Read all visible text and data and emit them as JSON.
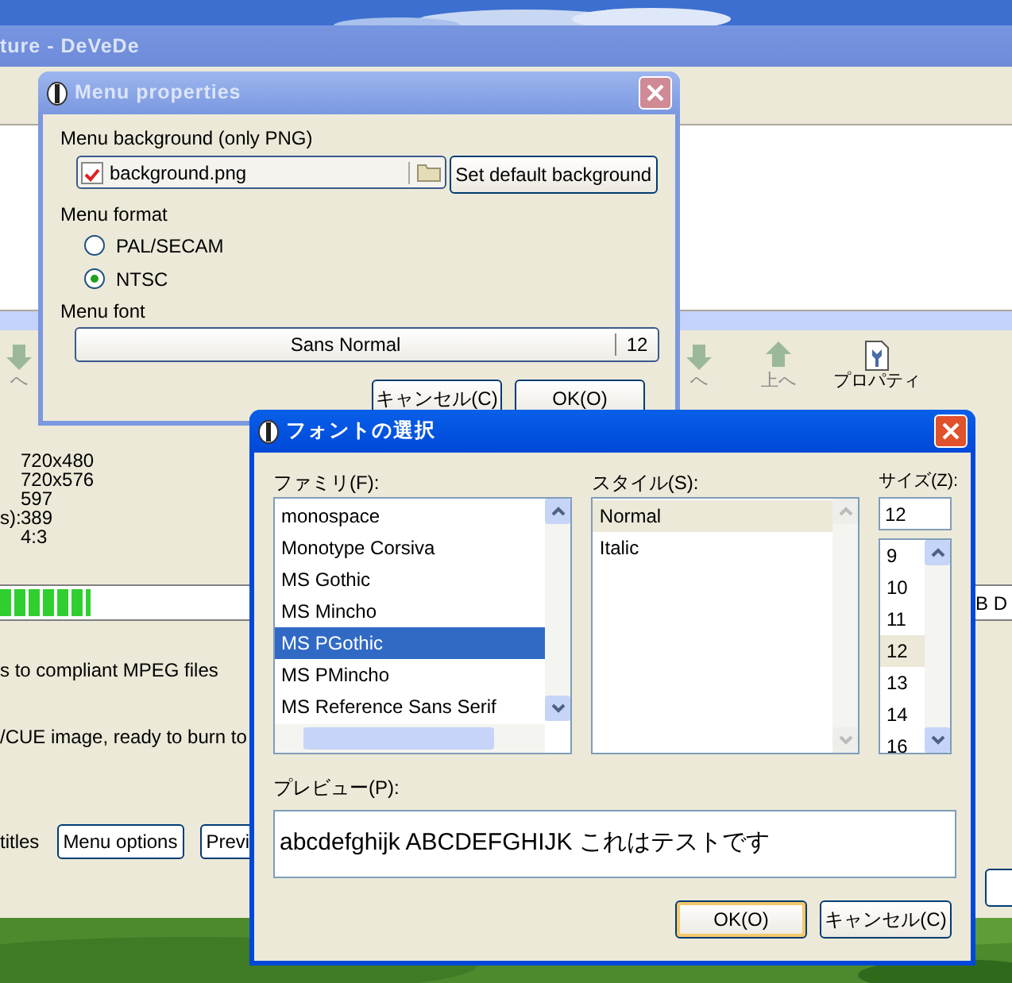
{
  "main_window": {
    "title": "ture - DeVeDe",
    "toolbar": [
      {
        "label": "へ",
        "kind": "down",
        "disabled": true
      },
      {
        "label": "へ",
        "kind": "down",
        "disabled": true
      },
      {
        "label": "上へ",
        "kind": "up",
        "disabled": true
      },
      {
        "label": "プロパティ",
        "kind": "properties",
        "disabled": false
      }
    ],
    "info": [
      {
        "value": "720x480"
      },
      {
        "value": "720x576"
      },
      {
        "value": "597"
      },
      {
        "label": "s):",
        "value": "389"
      },
      {
        "value": "4:3"
      }
    ],
    "progress": {
      "level": 0.09,
      "text": "B D"
    },
    "options": [
      "s to compliant MPEG files",
      "/CUE image, ready to burn to"
    ],
    "bottom_label": "titles",
    "bottom_buttons": [
      "Menu options",
      "Previ"
    ]
  },
  "menu_dialog": {
    "title": "Menu properties",
    "background_label": "Menu background (only PNG)",
    "background_file": "background.png",
    "default_button": "Set default background",
    "format_label": "Menu format",
    "formats": [
      {
        "label": "PAL/SECAM",
        "selected": false
      },
      {
        "label": "NTSC",
        "selected": true
      }
    ],
    "font_label": "Menu font",
    "font_name": "Sans Normal",
    "font_size": "12",
    "buttons": [
      "キャンセル(C)",
      "OK(O)"
    ]
  },
  "font_dialog": {
    "title": "フォントの選択",
    "family_label": "ファミリ(F):",
    "families": [
      {
        "name": "monospace",
        "selected": false
      },
      {
        "name": "Monotype Corsiva",
        "selected": false
      },
      {
        "name": "MS Gothic",
        "selected": false
      },
      {
        "name": "MS Mincho",
        "selected": false
      },
      {
        "name": "MS PGothic",
        "selected": true
      },
      {
        "name": "MS PMincho",
        "selected": false
      },
      {
        "name": "MS Reference Sans Serif",
        "selected": false
      }
    ],
    "style_label": "スタイル(S):",
    "styles": [
      {
        "name": "Normal",
        "selected": true
      },
      {
        "name": "Italic",
        "selected": false
      }
    ],
    "size_label": "サイズ(Z):",
    "size_value": "12",
    "sizes": [
      {
        "name": "9",
        "selected": false
      },
      {
        "name": "10",
        "selected": false
      },
      {
        "name": "11",
        "selected": false
      },
      {
        "name": "12",
        "selected": true
      },
      {
        "name": "13",
        "selected": false
      },
      {
        "name": "14",
        "selected": false
      },
      {
        "name": "16",
        "selected": false
      }
    ],
    "preview_label": "プレビュー(P):",
    "preview_text": "abcdefghijk ABCDEFGHIJK これはテストです",
    "buttons": [
      {
        "label": "OK(O)",
        "focused": true
      },
      {
        "label": "キャンセル(C)",
        "focused": false
      }
    ]
  }
}
